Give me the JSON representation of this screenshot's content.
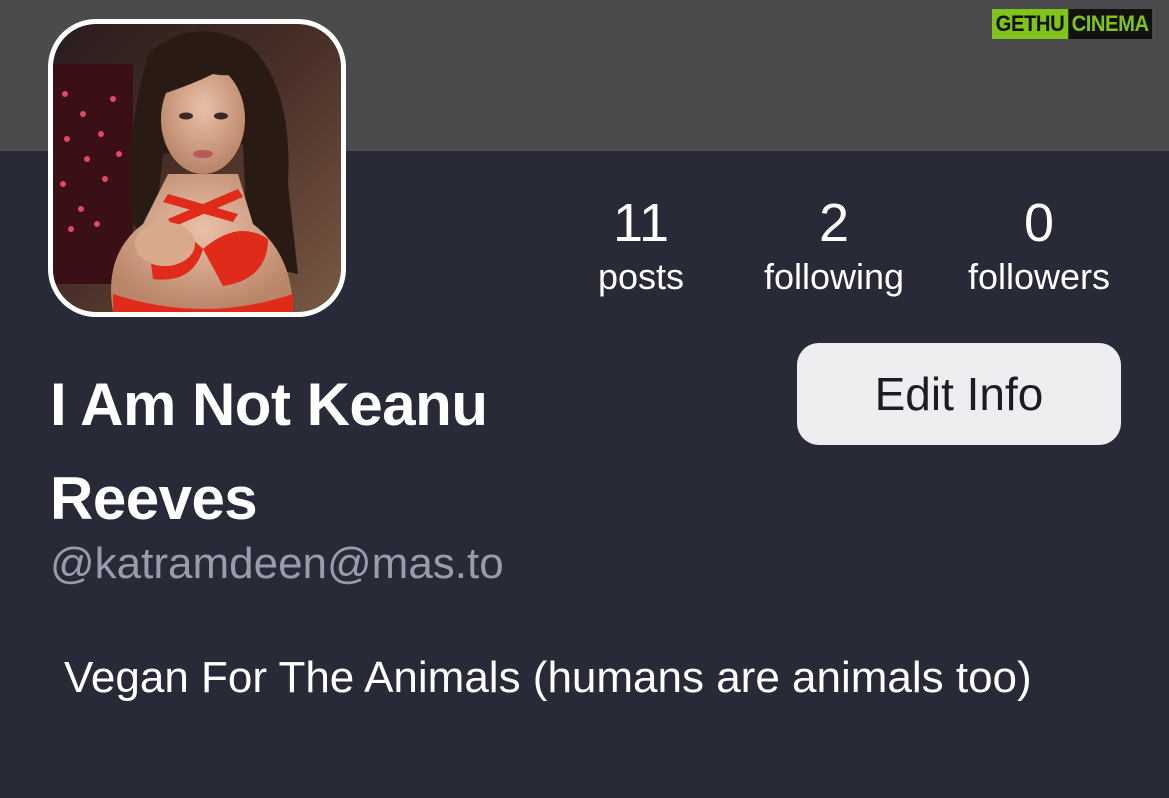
{
  "header": {
    "watermark": {
      "part1": "GETHU",
      "part2": "CINEMA"
    }
  },
  "profile": {
    "avatar_description_icon": "profile-photo",
    "display_name": "I Am Not Keanu Reeves",
    "handle": "@katramdeen@mas.to",
    "bio": "Vegan For The Animals (humans are animals too)"
  },
  "stats": {
    "posts": {
      "count": "11",
      "label": "posts"
    },
    "following": {
      "count": "2",
      "label": "following"
    },
    "followers": {
      "count": "0",
      "label": "followers"
    }
  },
  "actions": {
    "edit_label": "Edit Info"
  },
  "colors": {
    "background": "#282a38",
    "banner": "#4b4b4d",
    "handle": "#9a9bab",
    "button_bg": "#eeeef0",
    "watermark_green": "#7fc31c"
  }
}
